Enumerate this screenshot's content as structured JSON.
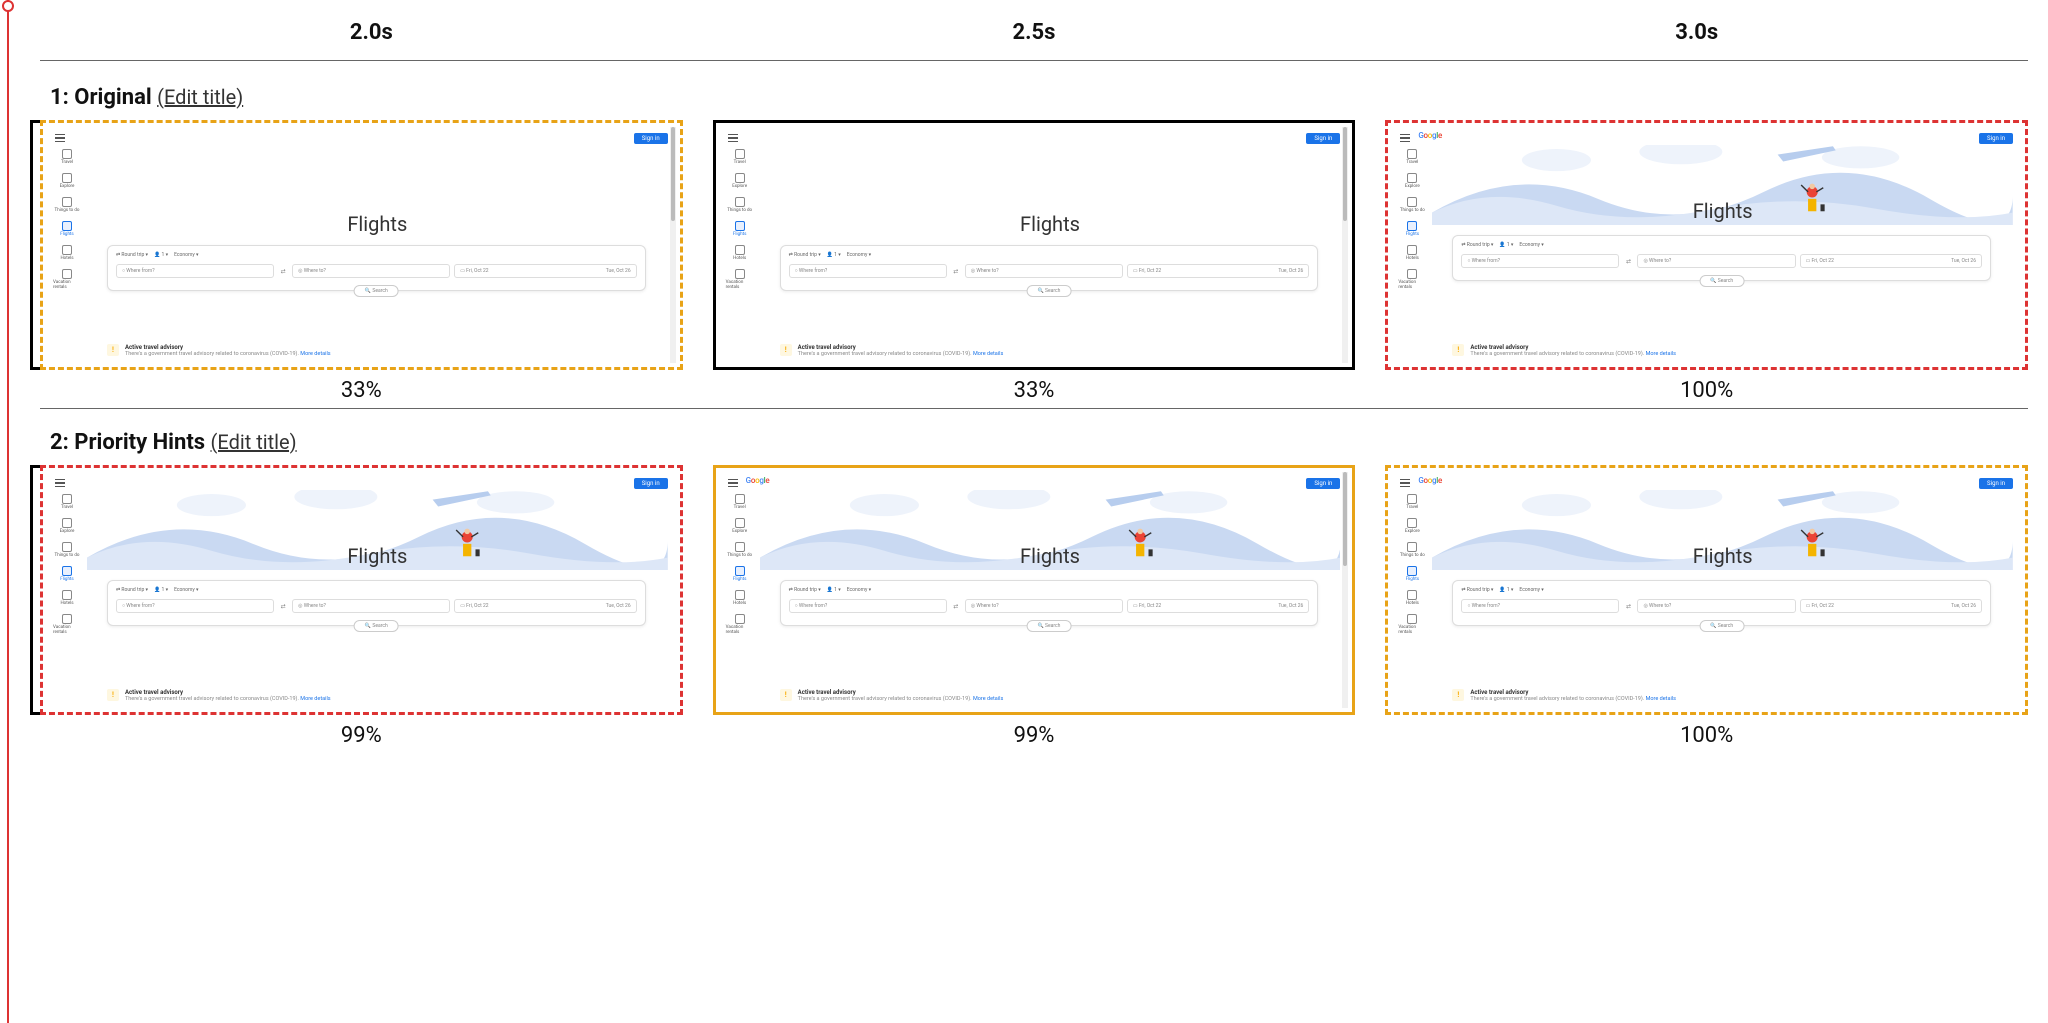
{
  "time_labels": [
    "2.0s",
    "2.5s",
    "3.0s"
  ],
  "rows": [
    {
      "index": "1",
      "name": "Original",
      "edit_label": "(Edit title)",
      "frames": [
        {
          "pct": "33%",
          "border": "dotted-y",
          "hero": false,
          "logo": false,
          "scroll": true
        },
        {
          "pct": "33%",
          "border": "solid-k",
          "hero": false,
          "logo": false,
          "scroll": true
        },
        {
          "pct": "100%",
          "border": "dotted-r",
          "hero": true,
          "logo": true,
          "scroll": false
        }
      ]
    },
    {
      "index": "2",
      "name": "Priority Hints",
      "edit_label": "(Edit title)",
      "frames": [
        {
          "pct": "99%",
          "border": "dotted-r",
          "hero": true,
          "logo": false,
          "scroll": false
        },
        {
          "pct": "99%",
          "border": "solid-y",
          "hero": true,
          "logo": true,
          "scroll": true
        },
        {
          "pct": "100%",
          "border": "dotted-y",
          "hero": true,
          "logo": true,
          "scroll": false
        }
      ]
    }
  ],
  "shot": {
    "signin": "Sign in",
    "logo_text": "Google",
    "title": "Flights",
    "sidebar": [
      "Travel",
      "Explore",
      "Things to do",
      "Flights",
      "Hotels",
      "Vacation rentals"
    ],
    "sidebar_active_index": 3,
    "chips": {
      "trip": "Round trip",
      "pax": "1",
      "class": "Economy"
    },
    "fields": {
      "from": "Where from?",
      "to": "Where to?",
      "d1": "Fri, Oct 22",
      "d2": "Tue, Oct 26"
    },
    "search": "Search",
    "advisory_title": "Active travel advisory",
    "advisory_body": "There's a government travel advisory related to coronavirus (COVID-19).",
    "advisory_link": "More details"
  }
}
